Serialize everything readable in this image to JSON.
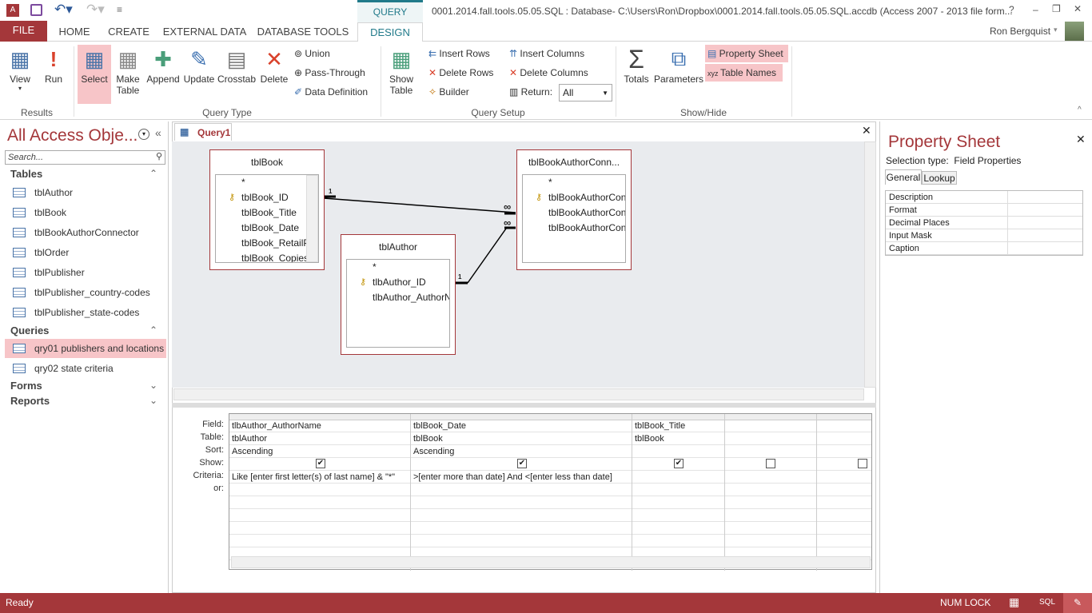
{
  "window": {
    "title": "0001.2014.fall.tools.05.05.SQL : Database- C:\\Users\\Ron\\Dropbox\\0001.2014.fall.tools.05.05.SQL.accdb (Access 2007 - 2013 file form...",
    "context_tab": "QUERY TOOLS",
    "help": "?",
    "minimize": "–",
    "restore": "❐",
    "close": "✕",
    "user": "Ron Bergquist"
  },
  "tabs": [
    "FILE",
    "HOME",
    "CREATE",
    "EXTERNAL DATA",
    "DATABASE TOOLS",
    "DESIGN"
  ],
  "ribbon": {
    "results": {
      "label": "Results",
      "view": "View",
      "run": "Run"
    },
    "query_type": {
      "label": "Query Type",
      "select": "Select",
      "make_table_1": "Make",
      "make_table_2": "Table",
      "append": "Append",
      "update": "Update",
      "crosstab": "Crosstab",
      "delete": "Delete",
      "union": "Union",
      "pass_through": "Pass-Through",
      "data_definition": "Data Definition"
    },
    "query_setup": {
      "label": "Query Setup",
      "show_table_1": "Show",
      "show_table_2": "Table",
      "insert_rows": "Insert Rows",
      "delete_rows": "Delete Rows",
      "builder": "Builder",
      "insert_columns": "Insert Columns",
      "delete_columns": "Delete Columns",
      "return_label": "Return:",
      "return_value": "All"
    },
    "show_hide": {
      "label": "Show/Hide",
      "totals": "Totals",
      "parameters": "Parameters",
      "property_sheet": "Property Sheet",
      "table_names": "Table Names"
    }
  },
  "nav": {
    "title": "All Access Obje...",
    "search_placeholder": "Search...",
    "sections": {
      "tables": "Tables",
      "queries": "Queries",
      "forms": "Forms",
      "reports": "Reports"
    },
    "tables": [
      "tblAuthor",
      "tblBook",
      "tblBookAuthorConnector",
      "tblOrder",
      "tblPublisher",
      "tblPublisher_country-codes",
      "tblPublisher_state-codes"
    ],
    "queries": [
      "qry01 publishers and locations",
      "qry02 state criteria"
    ]
  },
  "query": {
    "tab": "Query1",
    "tables": [
      {
        "name": "tblBook",
        "fields": [
          "*",
          "tblBook_ID",
          "tblBook_Title",
          "tblBook_Date",
          "tblBook_RetailP",
          "tblBook_Copies"
        ]
      },
      {
        "name": "tblAuthor",
        "fields": [
          "*",
          "tlbAuthor_ID",
          "tlbAuthor_AuthorN"
        ]
      },
      {
        "name": "tblBookAuthorConn...",
        "fields": [
          "*",
          "tblBookAuthorCon",
          "tblBookAuthorCon",
          "tblBookAuthorCon"
        ]
      }
    ],
    "join_one": "1",
    "join_many": "∞",
    "grid_labels": [
      "Field:",
      "Table:",
      "Sort:",
      "Show:",
      "Criteria:",
      "or:"
    ],
    "columns": [
      {
        "field": "tlbAuthor_AuthorName",
        "table": "tblAuthor",
        "sort": "Ascending",
        "show": true,
        "criteria": "Like [enter first letter(s) of last name] & \"*\""
      },
      {
        "field": "tblBook_Date",
        "table": "tblBook",
        "sort": "Ascending",
        "show": true,
        "criteria": ">[enter more than date] And <[enter less than date]"
      },
      {
        "field": "tblBook_Title",
        "table": "tblBook",
        "sort": "",
        "show": true,
        "criteria": ""
      },
      {
        "field": "",
        "table": "",
        "sort": "",
        "show": false,
        "criteria": ""
      },
      {
        "field": "",
        "table": "",
        "sort": "",
        "show": false,
        "criteria": ""
      }
    ]
  },
  "property_sheet": {
    "title": "Property Sheet",
    "selection_label": "Selection type:",
    "selection_value": "Field Properties",
    "tabs": [
      "General",
      "Lookup"
    ],
    "rows": [
      "Description",
      "Format",
      "Decimal Places",
      "Input Mask",
      "Caption"
    ]
  },
  "status": {
    "left": "Ready",
    "num_lock": "NUM LOCK",
    "sql": "SQL"
  },
  "colors": {
    "accent": "#a4373a",
    "highlight": "#f7c5c8",
    "context": "#217a8a"
  }
}
